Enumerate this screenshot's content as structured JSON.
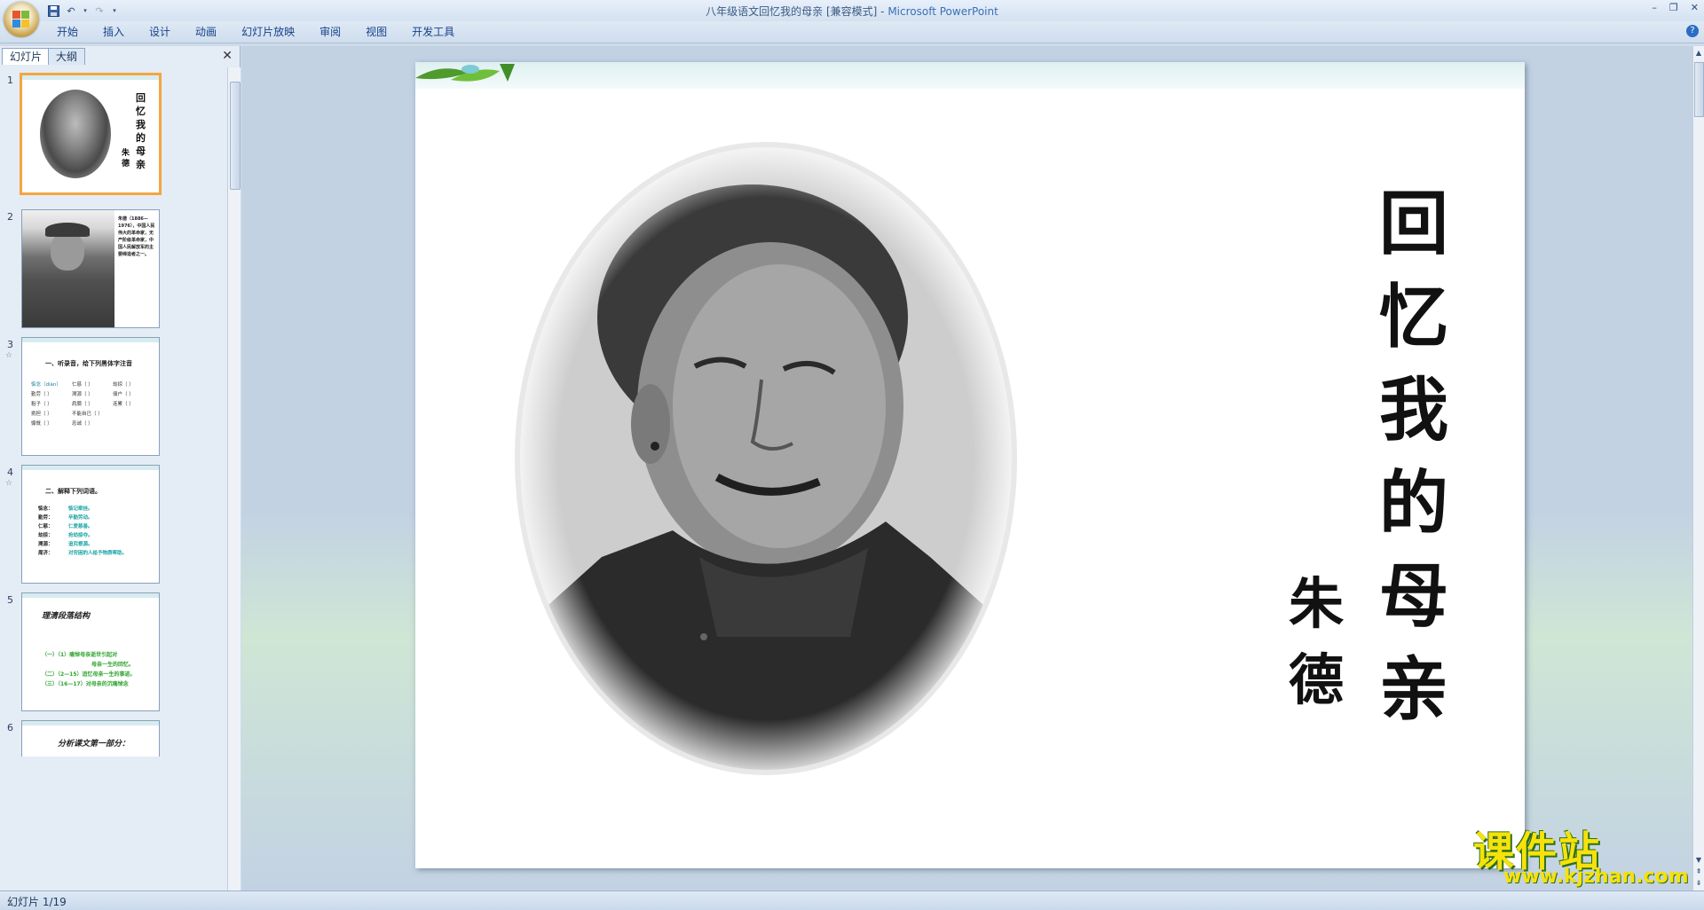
{
  "window": {
    "title": "八年级语文回忆我的母亲 [兼容模式] - ",
    "app_name": "Microsoft PowerPoint",
    "controls": [
      "–",
      "❐",
      "✕"
    ]
  },
  "ribbon": {
    "tabs": [
      "开始",
      "插入",
      "设计",
      "动画",
      "幻灯片放映",
      "审阅",
      "视图",
      "开发工具"
    ],
    "help": "?"
  },
  "left_pane": {
    "tabs": [
      "幻灯片",
      "大纲"
    ],
    "close": "✕",
    "slides": [
      {
        "num": "1"
      },
      {
        "num": "2",
        "text": "朱德（1886—1976），中国人民伟大的革命家，无产阶级革命家，中国人民解放军的主要缔造者之一。"
      },
      {
        "num": "3",
        "heading": "一、听录音，给下列黑体字注音",
        "rows": [
          [
            "惦念（diàn）",
            "仁慈（ ）",
            "劫掠（ ）"
          ],
          [
            "勤劳（ ）",
            "溯源（ ）",
            "佃户（ ）"
          ],
          [
            "租子（ ）",
            "肩膀（ ）",
            "连累（ ）"
          ],
          [
            "挑担（ ）",
            "不能自已（ ）",
            ""
          ],
          [
            "慷慨（ ）",
            "忠诚（ ）",
            ""
          ]
        ]
      },
      {
        "num": "4",
        "heading": "二、解释下列词语。",
        "rows": [
          [
            "惦念：",
            "惦记牵挂。"
          ],
          [
            "勤劳：",
            "辛勤劳动。"
          ],
          [
            "仁慈：",
            "仁爱慈善。"
          ],
          [
            "劫掠：",
            "抢劫掠夺。"
          ],
          [
            "溯源：",
            "追究根源。"
          ],
          [
            "周济：",
            "对穷困的人给予物质帮助。"
          ]
        ]
      },
      {
        "num": "5",
        "heading": "理清段落结构",
        "lines": [
          "（一）（1）痛悼母亲逝世引起对",
          "母亲一生的回忆。",
          "（二）（2—15）追忆母亲一生的事迹。",
          "（三）（16—17）对母亲的沉痛悼念"
        ]
      },
      {
        "num": "6",
        "heading": "分析课文第一部分："
      }
    ]
  },
  "slide": {
    "title_chars": [
      "回",
      "忆",
      "我",
      "的",
      "母",
      "亲"
    ],
    "author_chars": [
      "朱",
      "德"
    ]
  },
  "watermark": {
    "logo": "课件站",
    "url": "www.kjzhan.com"
  },
  "status": {
    "text": "幻灯片 1/19"
  }
}
